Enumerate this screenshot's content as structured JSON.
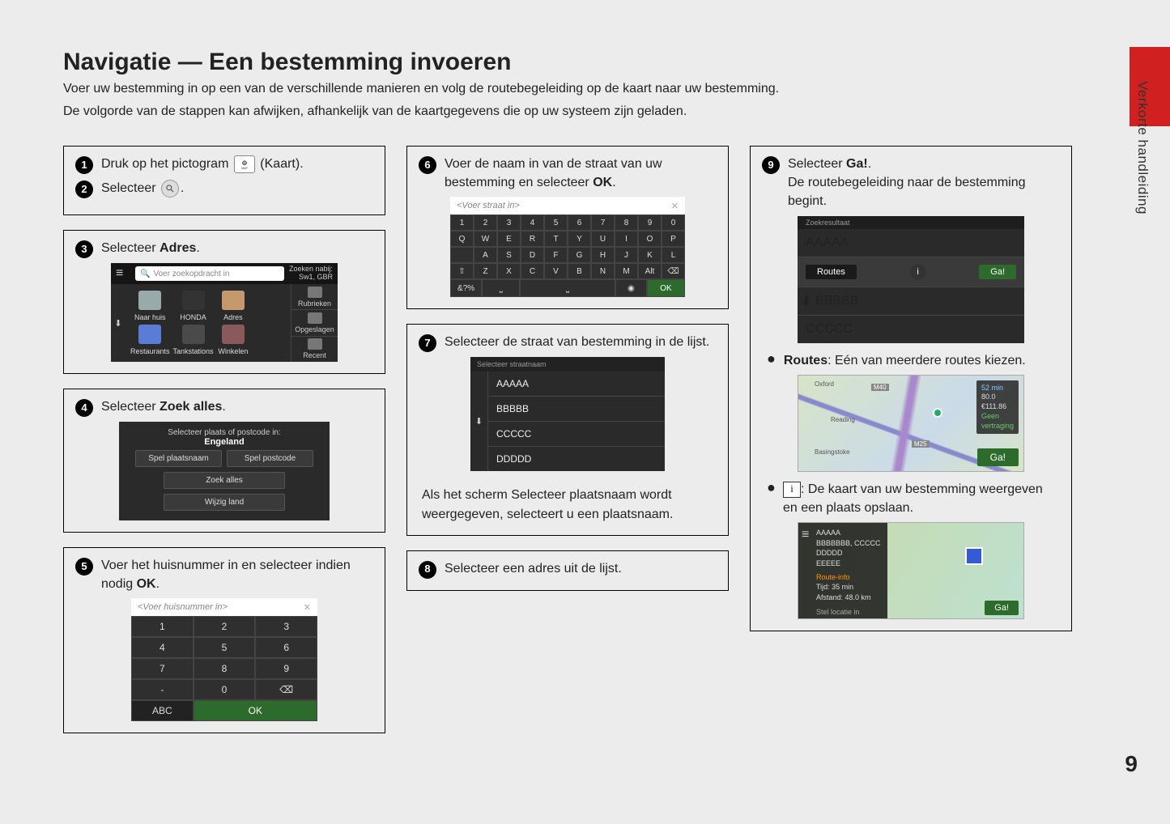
{
  "header": {
    "title": "Navigatie — Een bestemming invoeren",
    "intro1": "Voer uw bestemming in op een van de verschillende manieren en volg de routebegeleiding op de kaart naar uw bestemming.",
    "intro2": "De volgorde van de stappen kan afwijken, afhankelijk van de kaartgegevens die op uw systeem zijn geladen."
  },
  "side_label": "Verkorte handleiding",
  "page_number": "9",
  "steps": {
    "s1_pre": "Druk op het pictogram ",
    "s1_post": " (Kaart).",
    "s1_icon_sub": "MAP",
    "s2": "Selecteer ",
    "s3_pre": "Selecteer ",
    "s3_b": "Adres",
    "s3_post": ".",
    "s4_pre": "Selecteer ",
    "s4_b": "Zoek alles",
    "s4_post": ".",
    "s5_pre": "Voer het huisnummer in en selecteer indien nodig ",
    "s5_b": "OK",
    "s5_post": ".",
    "s6_pre": "Voer de naam in van de straat van uw bestemming en selecteer ",
    "s6_b": "OK",
    "s6_post": ".",
    "s7": "Selecteer de straat van bestemming in de lijst.",
    "s7_note": "Als het scherm Selecteer plaatsnaam wordt weergegeven, selecteert u een plaatsnaam.",
    "s8": "Selecteer een adres uit de lijst.",
    "s9_pre": "Selecteer ",
    "s9_b": "Ga!",
    "s9_post": ".",
    "s9_line2": "De routebegeleiding naar de bestemming begint."
  },
  "bullets": {
    "routes_b": "Routes",
    "routes_txt": ": Eén van meerdere routes kiezen.",
    "info_txt": ": De kaart van uw bestemming weergeven en een plaats opslaan."
  },
  "mock_search": {
    "placeholder": "Voer zoekopdracht in",
    "loc1": "Zoeken nabij:",
    "loc2": "Sw1, GBR",
    "icons": [
      "Naar huis",
      "HONDA",
      "Adres",
      "",
      "Restaurants",
      "Tankstations",
      "Winkelen",
      ""
    ],
    "side": [
      "Rubrieken",
      "Opgeslagen",
      "Recent"
    ]
  },
  "mock_place": {
    "title_pre": "Selecteer plaats of postcode in:",
    "title_b": "Engeland",
    "b1": "Spel plaatsnaam",
    "b2": "Spel postcode",
    "b3": "Zoek alles",
    "b4": "Wijzig land"
  },
  "mock_num": {
    "placeholder": "<Voer huisnummer in>",
    "abc": "ABC",
    "ok": "OK"
  },
  "mock_street": {
    "placeholder": "<Voer straat in>",
    "sym": "&?%",
    "ok": "OK",
    "alt": "Alt"
  },
  "mock_list": {
    "head": "Selecteer straatnaam",
    "items": [
      "AAAAA",
      "BBBBB",
      "CCCCC",
      "DDDDD"
    ]
  },
  "mock_result": {
    "head": "Zoekresultaat",
    "items": [
      "AAAAA",
      "BBBBB",
      "CCCCC"
    ],
    "routes": "Routes",
    "go": "Ga!"
  },
  "mock_map1": {
    "t1": "52 min",
    "t2": "80.0",
    "t3": "€111.86",
    "t4": "Geen",
    "t5": "vertraging",
    "go": "Ga!",
    "l1": "Oxford",
    "l2": "Reading",
    "l3": "Basingstoke",
    "l4": "M40",
    "l5": "M25"
  },
  "mock_map2": {
    "a": "AAAAA",
    "b": "BBBBBBB, CCCCC",
    "c": "DDDDD",
    "d": "EEEEE",
    "ri": "Route-info",
    "t": "Tijd: 35 min",
    "dst": "Afstand: 48.0 km",
    "stel": "Stel locatie in",
    "go": "Ga!"
  }
}
